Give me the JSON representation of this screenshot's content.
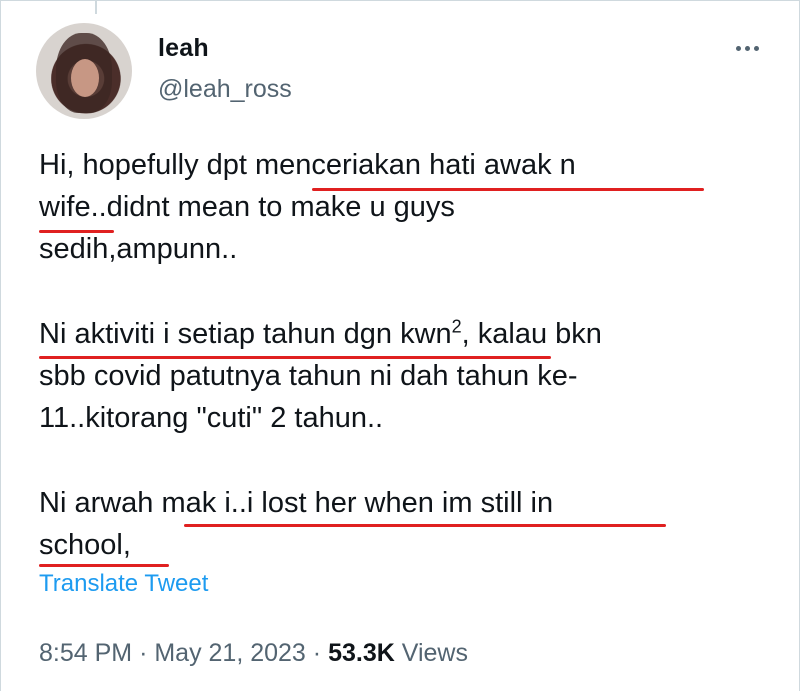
{
  "author": {
    "display_name": "leah",
    "handle": "@leah_ross"
  },
  "tweet": {
    "lines": [
      "Hi, hopefully dpt menceriakan hati awak n",
      "wife..didnt mean to make u guys",
      "sedih,ampunn..",
      "Ni aktiviti i setiap tahun dgn kwn",
      "2",
      ", kalau bkn",
      "sbb covid patutnya tahun ni dah tahun ke-",
      "11..kitorang \"cuti\" 2 tahun..",
      "Ni arwah mak i..i lost her when im still in",
      "school,"
    ],
    "translate_label": "Translate Tweet"
  },
  "meta": {
    "time": "8:54 PM",
    "separator": "·",
    "date": "May 21, 2023",
    "views_count": "53.3K",
    "views_label": "Views"
  },
  "icons": {
    "more": "more-horizontal-icon"
  },
  "colors": {
    "text": "#0f1419",
    "secondary": "#536471",
    "link": "#1d9bf0",
    "underline": "#e02020"
  }
}
